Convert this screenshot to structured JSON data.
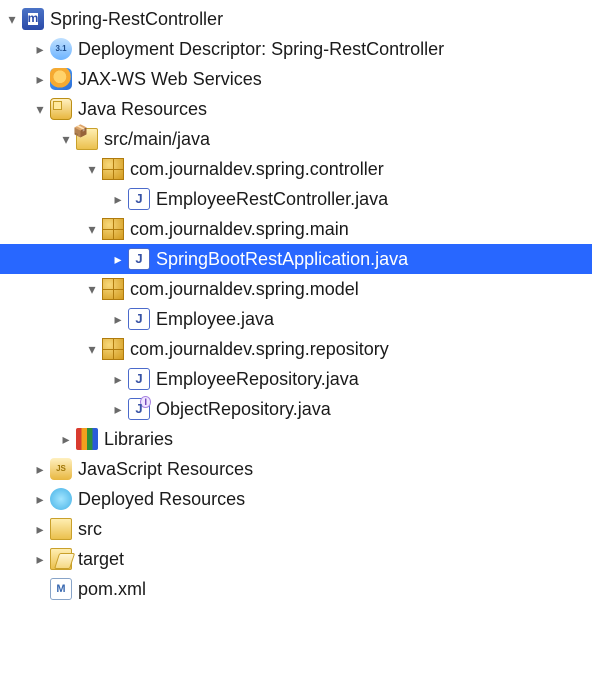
{
  "project": {
    "name": "Spring-RestController",
    "dd": "Deployment Descriptor: Spring-RestController",
    "jaxws": "JAX-WS Web Services",
    "javaRes": "Java Resources",
    "srcMain": "src/main/java",
    "pkgController": "com.journaldev.spring.controller",
    "fileController": "EmployeeRestController.java",
    "pkgMain": "com.journaldev.spring.main",
    "fileMain": "SpringBootRestApplication.java",
    "pkgModel": "com.journaldev.spring.model",
    "fileModel": "Employee.java",
    "pkgRepo": "com.journaldev.spring.repository",
    "fileRepo1": "EmployeeRepository.java",
    "fileRepo2": "ObjectRepository.java",
    "libraries": "Libraries",
    "jsRes": "JavaScript Resources",
    "deployed": "Deployed Resources",
    "srcFolder": "src",
    "targetFolder": "target",
    "pom": "pom.xml"
  }
}
